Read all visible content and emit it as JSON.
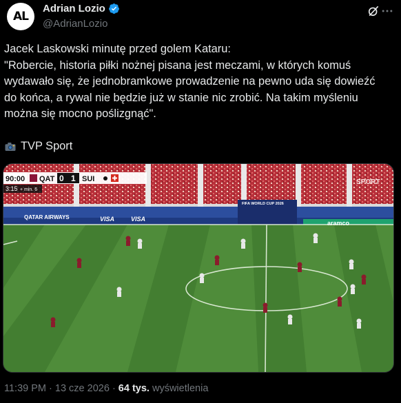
{
  "author": {
    "avatar_text": "AL",
    "display_name": "Adrian Lozio",
    "handle": "@AdrianLozio",
    "verified_color": "#1d9bf0"
  },
  "tweet": {
    "text": "Jacek Laskowski minutę przed golem Kataru:\n\"Robercie, historia piłki nożnej pisana jest meczami, w których komuś wydawało się, że jednobramkowe prowadzenie na pewno uda się dowieźć do końca, a rywal nie będzie już w stanie nic zrobić. Na takim myśleniu można się mocno poślizgnąć\".",
    "source": "TVP Sport",
    "source_icon": "camera-icon"
  },
  "media": {
    "scorebug": {
      "time": "90:00",
      "added_time": "3:15",
      "added_label": "+ min. 6",
      "home": "QAT",
      "home_score": "0",
      "away_score": "1",
      "away": "SUI"
    },
    "broadcaster": "SPORT",
    "ads": [
      "QATAR AIRWAYS",
      "VISA",
      "VISA",
      "FIFA WORLD CUP 2026",
      "aramco"
    ]
  },
  "meta": {
    "time": "11:39 PM",
    "date": "13 cze 2026",
    "views_count": "64 tys.",
    "views_label": "wyświetlenia"
  },
  "colors": {
    "background": "#000000",
    "text": "#e7e9ea",
    "muted": "#71767b",
    "pitch_light": "#4f8c3a",
    "pitch_dark": "#437e31"
  }
}
